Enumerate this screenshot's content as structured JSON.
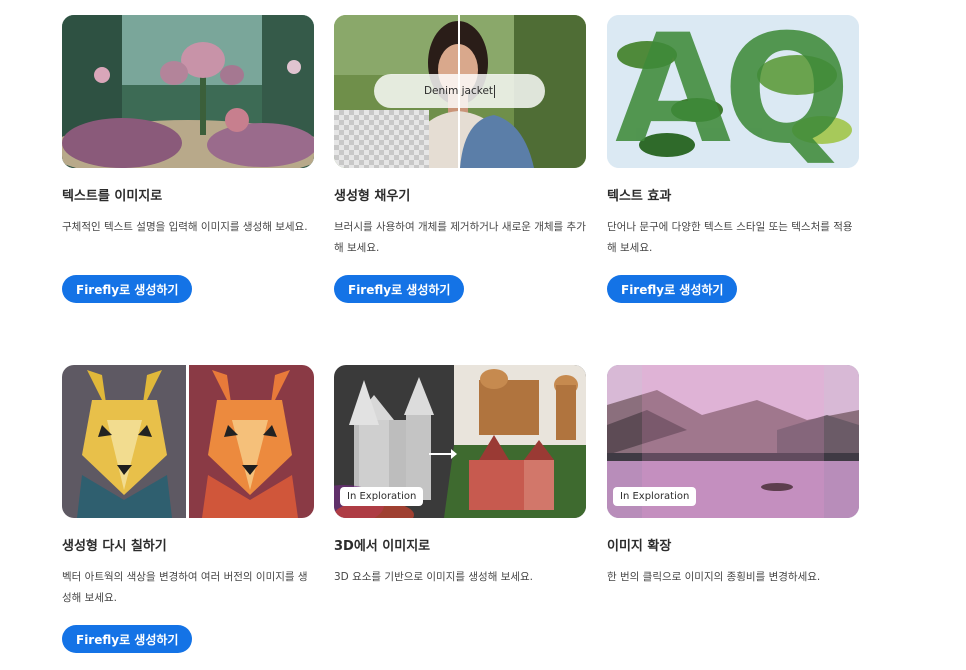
{
  "cards": [
    {
      "title": "텍스트를 이미지로",
      "desc": "구체적인 텍스트 설명을 입력해 이미지를 생성해 보세요.",
      "cta": "Firefly로 생성하기",
      "thumb_icon": "fantasy-garden-image"
    },
    {
      "title": "생성형 채우기",
      "desc": "브러시를 사용하여 개체를 제거하거나 새로운 개체를 추가해 보세요.",
      "cta": "Firefly로 생성하기",
      "prompt": "Denim jacket",
      "thumb_icon": "woman-portrait-image"
    },
    {
      "title": "텍스트 효과",
      "desc": "단어나 문구에 다양한 텍스트 스타일 또는 텍스처를 적용해 보세요.",
      "cta": "Firefly로 생성하기",
      "thumb_letters": "AQ",
      "thumb_icon": "leaf-letters-image"
    },
    {
      "title": "생성형 다시 칠하기",
      "desc": "벡터 아트웍의 색상을 변경하여 여러 버전의 이미지를 생성해 보세요.",
      "cta": "Firefly로 생성하기",
      "thumb_icon": "dog-vector-image"
    },
    {
      "title": "3D에서 이미지로",
      "desc": "3D 요소를 기반으로 이미지를 생성해 보세요.",
      "badge": "In Exploration",
      "thumb_icon": "castle-3d-image"
    },
    {
      "title": "이미지 확장",
      "desc": "한 번의 클릭으로 이미지의 종횡비를 변경하세요.",
      "badge": "In Exploration",
      "thumb_icon": "lake-landscape-image"
    }
  ],
  "colors": {
    "accent": "#1473e6",
    "title": "#2c2c2c",
    "text": "#464646"
  }
}
